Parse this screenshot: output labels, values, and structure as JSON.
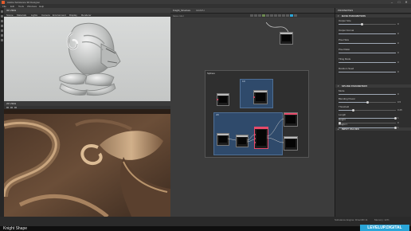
{
  "window": {
    "title": "Adobe Substance 3D Designer",
    "controls": [
      "–",
      "□",
      "✕"
    ]
  },
  "menu": [
    "File",
    "Edit",
    "Tools",
    "Windows",
    "Help"
  ],
  "panels": {
    "view3d": {
      "title": "3D VIEW",
      "menus": [
        "Scene",
        "Materials",
        "Lights",
        "Camera",
        "Environment",
        "Display",
        "Renderer"
      ]
    },
    "view2d": {
      "title": "2D VIEW"
    },
    "graph": {
      "title": "GRAPH",
      "tab": "Knight_Structure",
      "output_label": "base color",
      "frame_title": "Splines",
      "subframe_1_title": "1R",
      "subframe_2_title": "2R"
    },
    "properties": {
      "title": "PROPERTIES",
      "sections": [
        "BASE PARAMETERS",
        "SPLINE PARAMETERS",
        "INPUT VALUES"
      ],
      "rows": [
        {
          "label": "Output Size",
          "value": "0"
        },
        {
          "label": "Output Format",
          "value": "0"
        },
        {
          "label": "Pixel Size",
          "value": "0"
        },
        {
          "label": "Pixel Ratio",
          "value": "0"
        },
        {
          "label": "Tiling Mode",
          "value": "0"
        },
        {
          "label": "Random Seed",
          "value": "0"
        },
        {
          "label": "Mode",
          "value": "0"
        },
        {
          "label": "Blending Power",
          "value": "0.5"
        },
        {
          "label": "Threshold",
          "value": "0.25"
        },
        {
          "label": "Length",
          "value": "1"
        },
        {
          "label": "Height",
          "value": "0"
        },
        {
          "label": "Height Y",
          "value": "1"
        }
      ]
    }
  },
  "status": {
    "engine": "Substance Engine: Direct3D 11",
    "memory": "Memory: 12%"
  },
  "caption": {
    "left": "Knight Shape",
    "right": "LEVELUP.DIGITAL"
  },
  "colors": {
    "accent": "#2aa5d8",
    "node_red": "#e84a6a",
    "frame_blue": "#2f4a6b"
  }
}
